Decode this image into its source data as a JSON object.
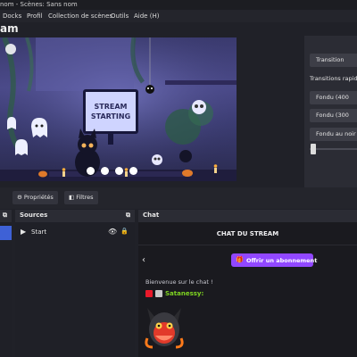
{
  "window": {
    "title": "nom - Scènes: Sans nom"
  },
  "menu": {
    "items": [
      "Docks",
      "Profil",
      "Collection de scènes",
      "Outils",
      "Aide (H)"
    ]
  },
  "studio": {
    "title": "am"
  },
  "preview": {
    "sign_line1": "STREAM",
    "sign_line2": "STARTING",
    "dots_count": 4
  },
  "transitions": {
    "transition_button": "Transition",
    "quick_label": "Transitions rapides",
    "buttons": [
      "Fondu (400",
      "Fondu (300",
      "Fondu au noir"
    ]
  },
  "toolbar": {
    "properties": "Propriétés",
    "filters": "Filtres"
  },
  "sources": {
    "title": "Sources",
    "items": [
      {
        "name": "Start"
      }
    ]
  },
  "chat": {
    "dock_title": "Chat",
    "header": "CHAT DU STREAM",
    "subscribe_button": "Offrir un abonnement",
    "welcome": "Bienvenue sur le chat !",
    "messages": [
      {
        "user": "Satanessy:"
      }
    ]
  },
  "colors": {
    "accent": "#3e61d6",
    "subscribe": "#9147ff",
    "username": "#7ed321",
    "panel_bg": "#202128"
  }
}
